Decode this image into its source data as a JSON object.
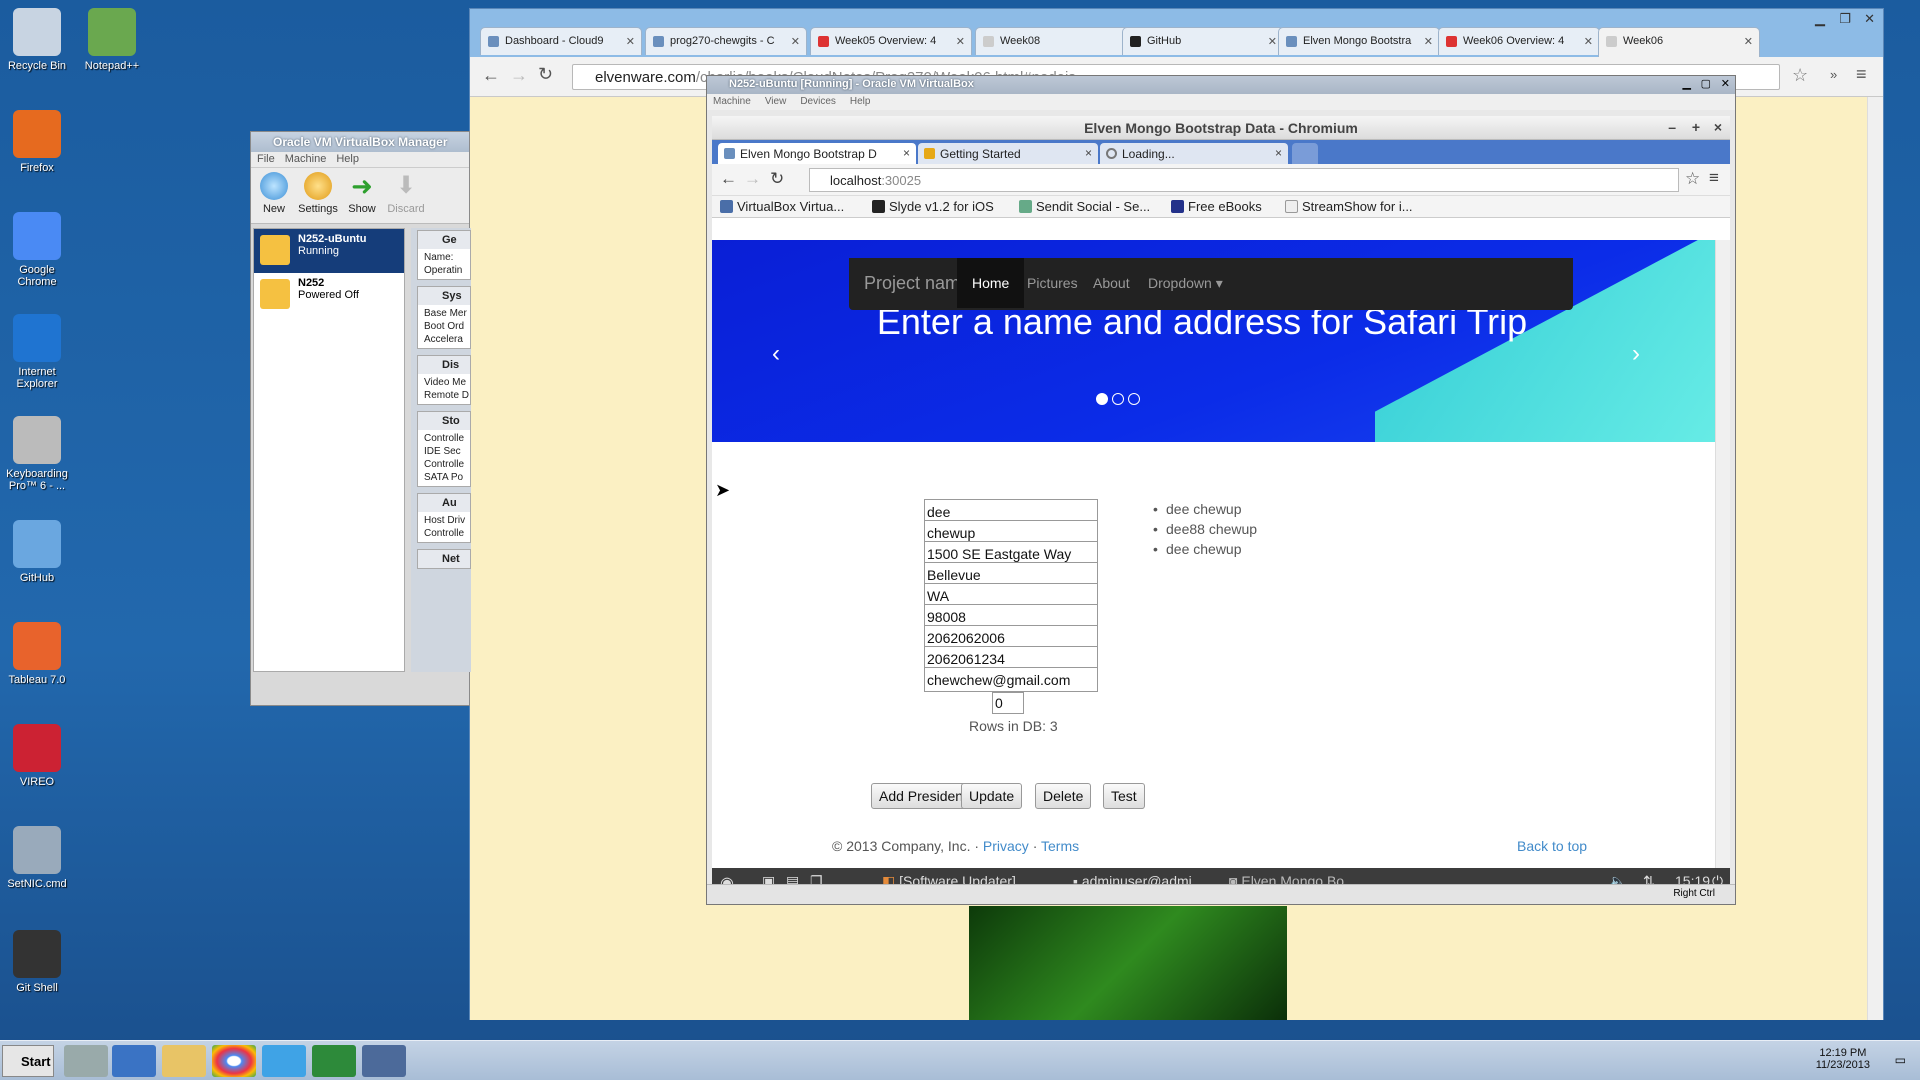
{
  "desktop": {
    "icons": [
      {
        "label": "Recycle Bin",
        "icon": "recycle-bin-icon"
      },
      {
        "label": "Notepad++",
        "icon": "notepadpp-icon"
      },
      {
        "label": "Firefox",
        "icon": "firefox-icon"
      },
      {
        "label": "Google Chrome",
        "icon": "chrome-icon"
      },
      {
        "label": "Internet Explorer",
        "icon": "ie-icon"
      },
      {
        "label": "Keyboarding Pro™ 6 - ...",
        "icon": "keyboarding-icon"
      },
      {
        "label": "GitHub",
        "icon": "github-icon"
      },
      {
        "label": "Tableau 7.0",
        "icon": "tableau-icon"
      },
      {
        "label": "VIREO",
        "icon": "vireo-icon"
      },
      {
        "label": "SetNIC.cmd",
        "icon": "cmd-icon"
      },
      {
        "label": "Git Shell",
        "icon": "git-shell-icon"
      }
    ]
  },
  "outer_browser": {
    "tabs": [
      "Dashboard - Cloud9",
      "prog270-chewgits - C",
      "Week05 Overview: 4",
      "Week08",
      "GitHub",
      "Elven Mongo Bootstra",
      "Week06 Overview: 4",
      "Week06"
    ],
    "url_domain": "elvenware.com",
    "url_path": "/charlie/books/CloudNotes/Prog270/Week06.html#nodejs"
  },
  "vbox_manager": {
    "title": "Oracle VM VirtualBox Manager",
    "menu": [
      "File",
      "Machine",
      "Help"
    ],
    "toolbar": [
      "New",
      "Settings",
      "Show",
      "Discard"
    ],
    "vms": [
      {
        "name": "N252-uBuntu",
        "state": "Running"
      },
      {
        "name": "N252",
        "state": "Powered Off"
      }
    ],
    "sections": [
      {
        "title": "Ge",
        "lines": [
          "Name:",
          "Operatin"
        ]
      },
      {
        "title": "Sys",
        "lines": [
          "Base Mer",
          "Boot Ord",
          "Accelera"
        ]
      },
      {
        "title": "Dis",
        "lines": [
          "Video Me",
          "Remote D"
        ]
      },
      {
        "title": "Sto",
        "lines": [
          "Controlle",
          "  IDE Sec",
          "Controlle",
          "  SATA Po"
        ]
      },
      {
        "title": "Au",
        "lines": [
          "Host Driv",
          "Controlle"
        ]
      },
      {
        "title": "Net",
        "lines": []
      }
    ]
  },
  "vm_window": {
    "title": "N252-uBuntu [Running] - Oracle VM VirtualBox",
    "menu": [
      "Machine",
      "View",
      "Devices",
      "Help"
    ],
    "host_key": "Right Ctrl"
  },
  "inner_browser": {
    "title": "Elven Mongo Bootstrap Data - Chromium",
    "tabs": [
      "Elven Mongo Bootstrap D",
      "Getting Started",
      "Loading..."
    ],
    "url_host": "localhost",
    "url_port": ":30025",
    "bookmarks": [
      "VirtualBox Virtua...",
      "Slyde v1.2 for iOS",
      "Sendit Social - Se...",
      "Free eBooks",
      "StreamShow for i..."
    ]
  },
  "page": {
    "nav": {
      "brand": "Project name",
      "items": [
        "Home",
        "Pictures",
        "About",
        "Dropdown"
      ]
    },
    "carousel_text": "Enter a name and address for Safari Trip",
    "form": {
      "first": "dee",
      "last": "chewup",
      "address": "1500 SE Eastgate Way",
      "city": "Bellevue",
      "state": "WA",
      "zip": "98008",
      "phone1": "2062062006",
      "phone2": "2062061234",
      "email": "chewchew@gmail.com",
      "index": "0"
    },
    "rows_label": "Rows in DB: 3",
    "buttons": [
      "Add President",
      "Update",
      "Delete",
      "Test"
    ],
    "list": [
      "dee chewup",
      "dee88 chewup",
      "dee chewup"
    ],
    "footer": {
      "copy": "© 2013 Company, Inc. · ",
      "privacy": "Privacy",
      "sep": " · ",
      "terms": "Terms",
      "back": "Back to top"
    }
  },
  "linux_taskbar": {
    "items": [
      "[Software Updater]",
      "adminuser@admi...",
      "Elven Mongo Bo..."
    ],
    "time": "15:19"
  },
  "taskbar": {
    "start": "Start",
    "time": "12:19 PM",
    "date": "11/23/2013"
  }
}
